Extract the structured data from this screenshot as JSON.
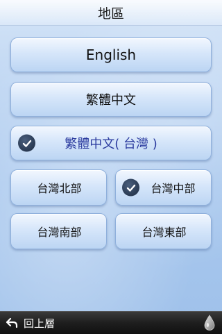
{
  "header": {
    "title": "地區"
  },
  "options": {
    "english": "English",
    "traditional": "繁體中文",
    "traditional_tw": "繁體中文( 台灣 )"
  },
  "regions": {
    "north": "台灣北部",
    "central": "台灣中部",
    "south": "台灣南部",
    "east": "台灣東部"
  },
  "footer": {
    "back_label": "回上層"
  },
  "icons": {
    "check": "check-circle-icon",
    "back": "back-arrow-icon",
    "drop": "water-drop-icon"
  },
  "colors": {
    "selected_text": "#2a3a9e",
    "background": "#a9c8ee"
  }
}
